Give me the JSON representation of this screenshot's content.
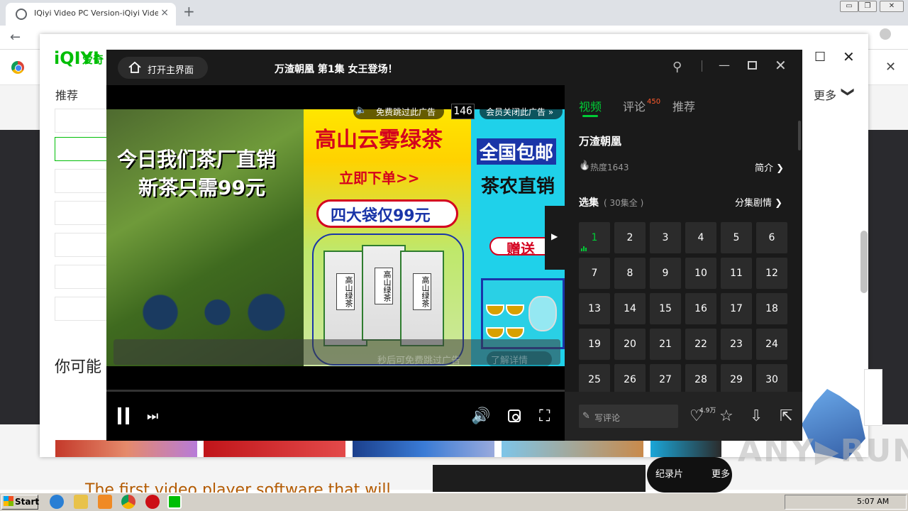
{
  "browser": {
    "tab_title": "IQiyi Video PC Version-iQiyi Video Of",
    "tab_close": "×",
    "new_tab": "+",
    "window_buttons": [
      "▭",
      "❐",
      "✕"
    ],
    "nav_icons": [
      "arrow-left",
      "arrow-right",
      "reload"
    ],
    "infobar_close": "✕"
  },
  "background_page": {
    "logo": "iQIYI",
    "logo_cn": "爱奇",
    "recommend": "推荐",
    "you_might": "你可能",
    "more": "更多",
    "more_chevron": "❯",
    "max_icon": "☐",
    "close_icon": "✕",
    "bottom_text": "The first video player software that will",
    "mini_documentary": "纪录片",
    "mini_more": "更多",
    "watermark": "ANY▶RUN"
  },
  "player": {
    "home_button": "打开主界面",
    "episode_title": "万渣朝凰 第1集 女王登场！",
    "pin_icon": "⚲",
    "min_icon": "—",
    "close_icon": "✕",
    "ad": {
      "skip_icon": "🔈",
      "skip_label": "免费跳过此广告",
      "timer": "146",
      "vip_label": "会员关闭此广告 »",
      "left_line1": "今日我们茶厂直销",
      "left_line2": "新茶只需99元",
      "mid_title": "高山云雾绿茶",
      "mid_order": "立即下单>>",
      "mid_price": "四大袋仅99元",
      "bag_label": "高山绿茶",
      "right_line1": "全国包邮",
      "right_line2": "茶农直销",
      "gift": "赠送",
      "bottom_text": "秒后可免费跳过广告",
      "learn_more": "了解详情"
    },
    "controls": {
      "next_icon": "⏭",
      "volume_icon": "🔊",
      "fullscreen_icon": "⛶"
    },
    "side_toggle_icon": "▶"
  },
  "side_panel": {
    "tabs": [
      {
        "label": "视频",
        "active": true
      },
      {
        "label": "评论",
        "badge": "450"
      },
      {
        "label": "推荐"
      }
    ],
    "show_title": "万渣朝凰",
    "heat_icon": "🔥",
    "heat": "热度1643",
    "intro": "简介 ❯",
    "select_label": "选集",
    "select_sub": "( 30集全 )",
    "plot_link": "分集剧情 ❯",
    "episodes": [
      "1",
      "2",
      "3",
      "4",
      "5",
      "6",
      "7",
      "8",
      "9",
      "10",
      "11",
      "12",
      "13",
      "14",
      "15",
      "16",
      "17",
      "18",
      "19",
      "20",
      "21",
      "22",
      "23",
      "24",
      "25",
      "26",
      "27",
      "28",
      "29",
      "30"
    ],
    "current_episode": "1",
    "comment_placeholder": "写评论",
    "pen_icon": "✎",
    "like_icon": "♡",
    "like_count": "4.9万",
    "star_icon": "☆",
    "download_icon": "⇩",
    "share_icon": "⇱"
  },
  "taskbar": {
    "start": "Start",
    "clock": "5:07 AM"
  },
  "colors": {
    "accent": "#00cc36",
    "badge": "#ff5a2b",
    "panel_bg": "#1a1a1a",
    "ad_red": "#d4001e",
    "ad_blue": "#1a35a8"
  }
}
